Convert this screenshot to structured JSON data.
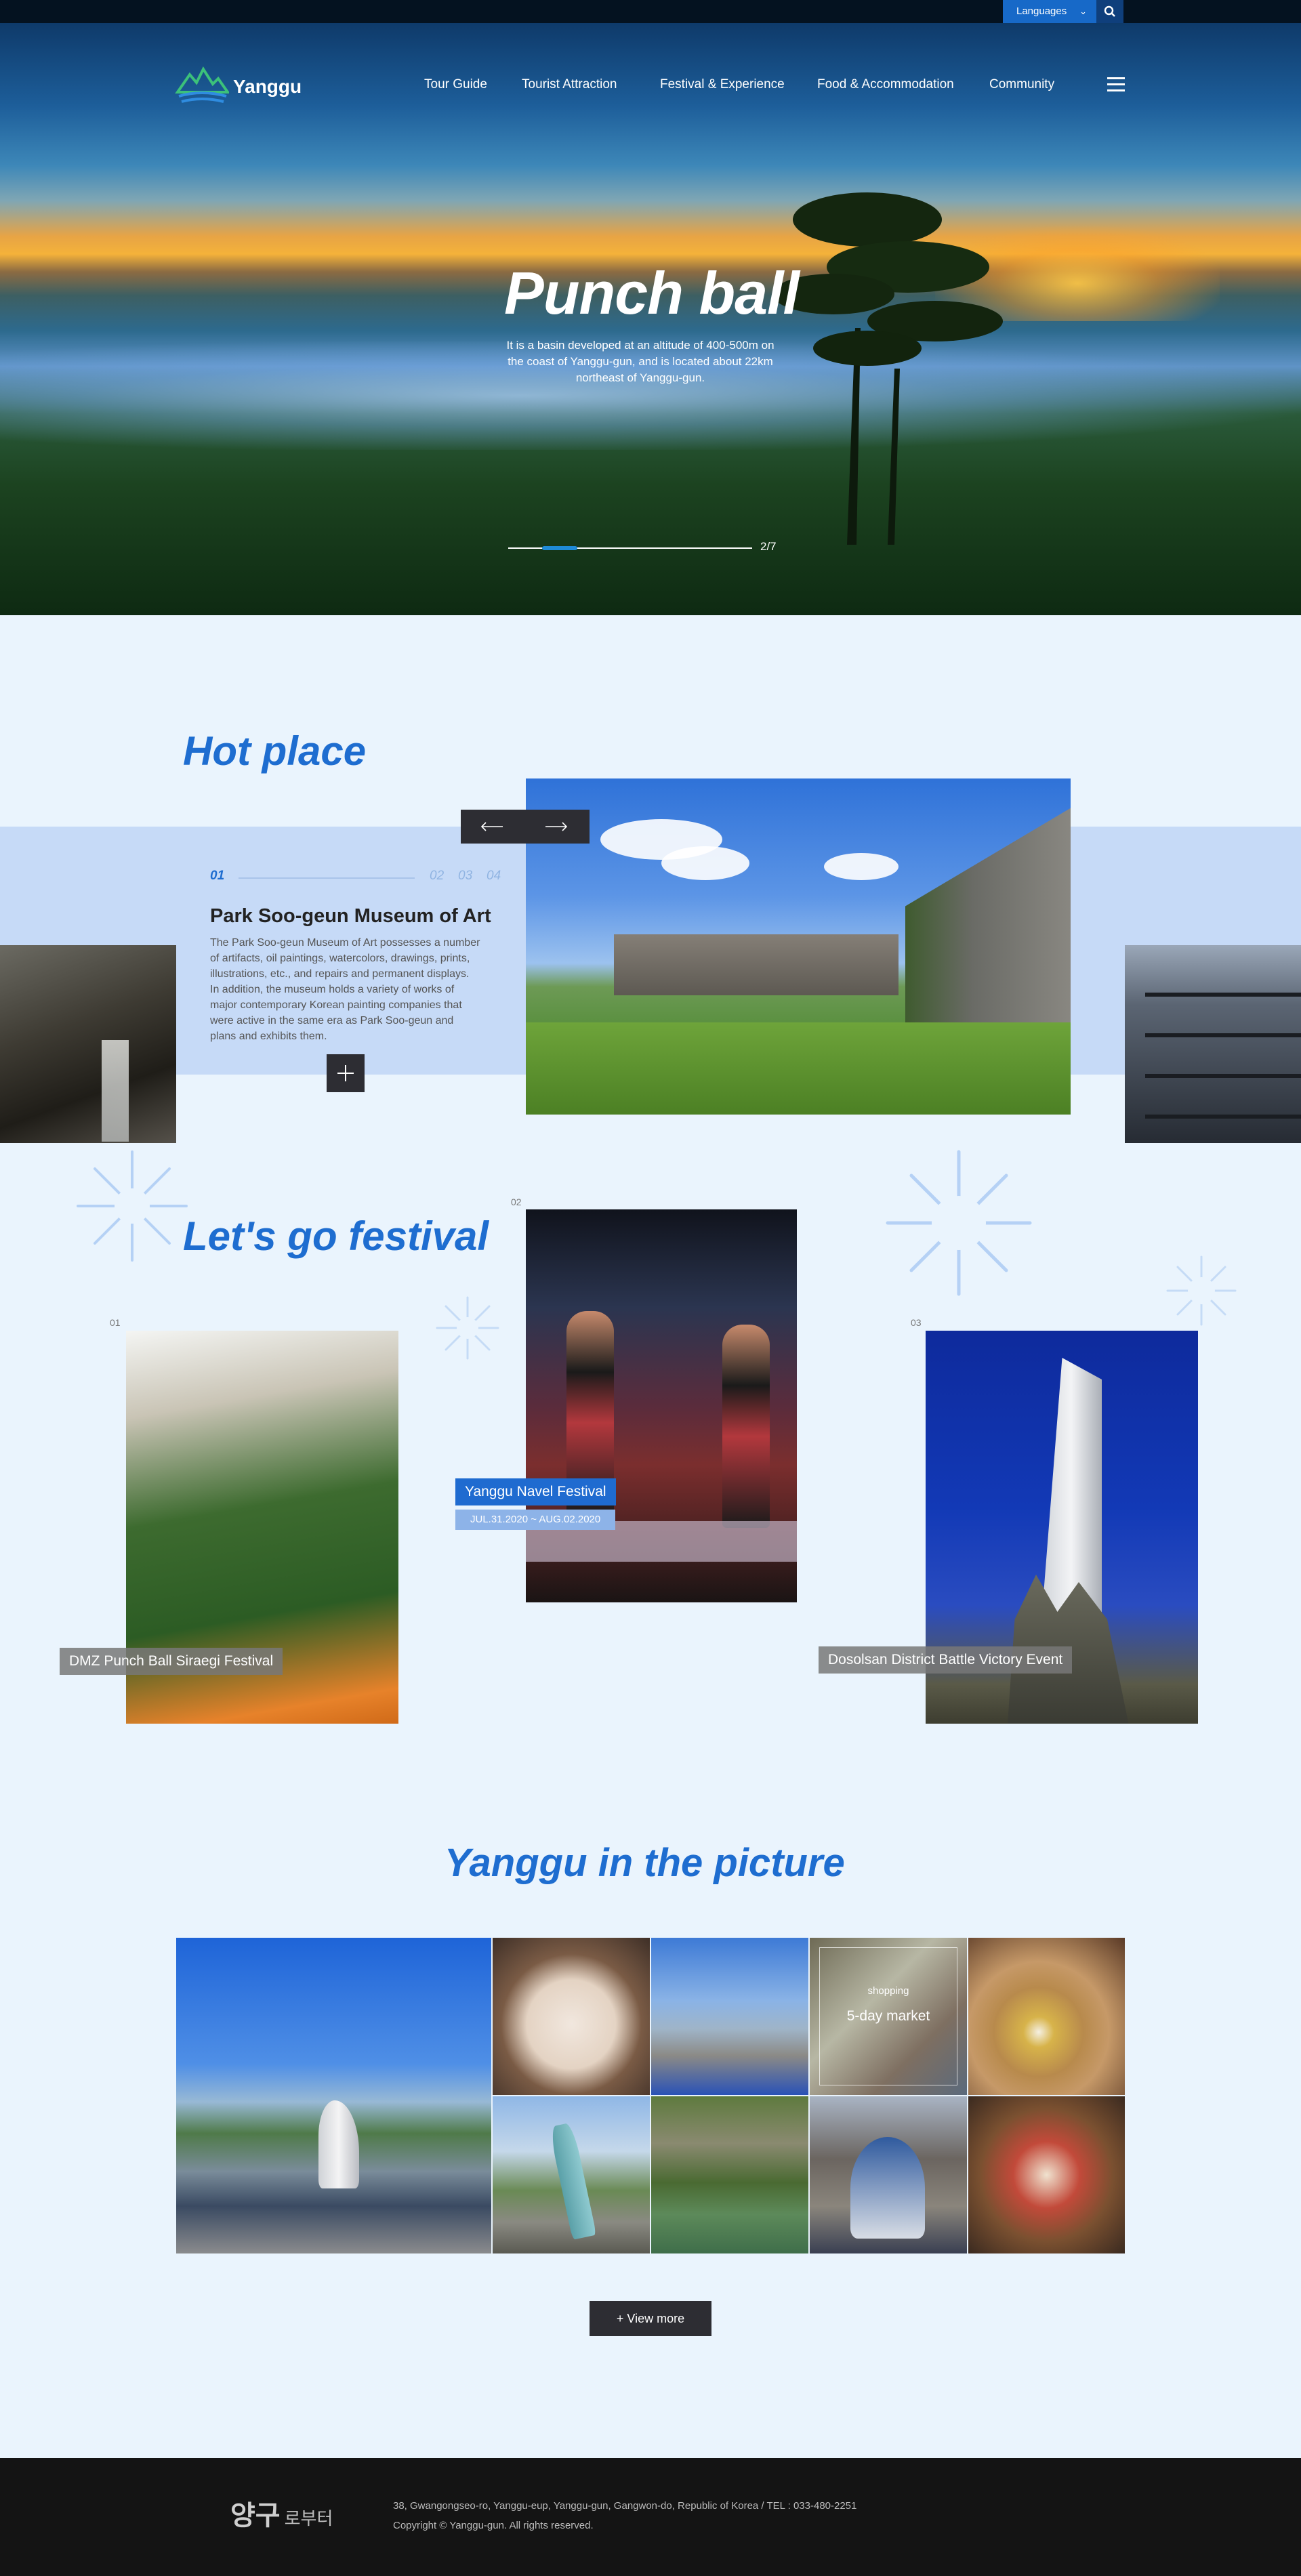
{
  "utility": {
    "languages_label": "Languages"
  },
  "header": {
    "logo_text": "Yanggu",
    "nav": [
      "Tour Guide",
      "Tourist Attraction",
      "Festival & Experience",
      "Food & Accommodation",
      "Community"
    ]
  },
  "hero": {
    "title": "Punch ball",
    "description": "It is a basin developed at an altitude of 400-500m on the coast of Yanggu-gun, and is located about 22km northeast of Yanggu-gun.",
    "counter": "2/7",
    "progress": 0.14
  },
  "hot_place": {
    "section_title": "Hot place",
    "numbers": [
      "01",
      "02",
      "03",
      "04"
    ],
    "active_index": 0,
    "item_title": "Park Soo-geun Museum of Art",
    "item_description": "The Park Soo-geun Museum of Art possesses a number of artifacts, oil paintings, watercolors, drawings, prints, illustrations, etc., and repairs and permanent displays. In addition, the museum holds a variety of works of major contemporary Korean painting companies that were active in the same era as Park Soo-geun and plans and exhibits them."
  },
  "festival": {
    "section_title": "Let's go festival",
    "items": [
      {
        "num": "01",
        "title": "DMZ Punch Ball Siraegi Festival"
      },
      {
        "num": "02",
        "title": "Yanggu Navel Festival",
        "date": "JUL.31.2020 ~ AUG.02.2020"
      },
      {
        "num": "03",
        "title": "Dosolsan District Battle Victory Event"
      }
    ]
  },
  "picture": {
    "section_title": "Yanggu in the picture",
    "overlay_category": "shopping",
    "overlay_title": "5-day market",
    "view_more": "+ View more"
  },
  "footer": {
    "logo_main": "양구",
    "logo_sub": "로부터",
    "address": "38, Gwangongseo-ro, Yanggu-eup, Yanggu-gun, Gangwon-do, Republic of Korea   /  TEL : 033-480-2251",
    "copyright": "Copyright © Yanggu-gun. All rights reserved."
  }
}
